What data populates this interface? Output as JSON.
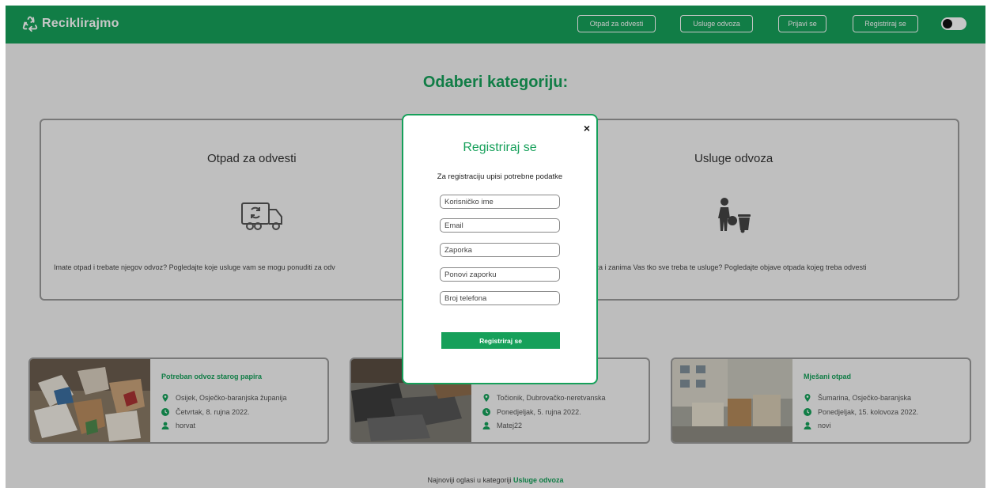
{
  "header": {
    "brand": "Reciklirajmo",
    "nav": [
      "Otpad za odvesti",
      "Usluge odvoza",
      "Prijavi se",
      "Registriraj se"
    ],
    "accent": "#16a05a"
  },
  "main": {
    "title": "Odaberi kategoriju:",
    "categories": [
      {
        "title": "Otpad za odvesti",
        "desc": "Imate otpad i trebate njegov odvoz? Pogledajte koje usluge vam se mogu ponuditi za odv",
        "icon": "truck-recycle-icon"
      },
      {
        "title": "Usluge odvoza",
        "desc": "dvoza i zanima Vas tko sve treba te usluge? Pogledajte objave otpada kojeg treba odvesti",
        "icon": "trash-worker-icon"
      }
    ]
  },
  "cards": [
    {
      "title": "Potreban odvoz starog papira",
      "location": "Osijek, Osječko-baranjska županija",
      "date": "Četvrtak, 8. rujna 2022.",
      "user": "horvat"
    },
    {
      "title": "",
      "location": "Točionik, Dubrovačko-neretvanska",
      "date": "Ponedjeljak, 5. rujna 2022.",
      "user": "Matej22"
    },
    {
      "title": "Mješani otpad",
      "location": "Šumarina, Osječko-baranjska",
      "date": "Ponedjeljak, 15. kolovoza 2022.",
      "user": "novi"
    }
  ],
  "footer": {
    "prefix": "Najnoviji oglasi u kategoriji",
    "link": "Usluge odvoza"
  },
  "modal": {
    "close": "×",
    "title": "Registriraj se",
    "subtitle": "Za registraciju upisi potrebne podatke",
    "fields": [
      "Korisničko ime",
      "Email",
      "Zaporka",
      "Ponovi zaporku",
      "Broj telefona"
    ],
    "submit": "Registriraj se"
  }
}
